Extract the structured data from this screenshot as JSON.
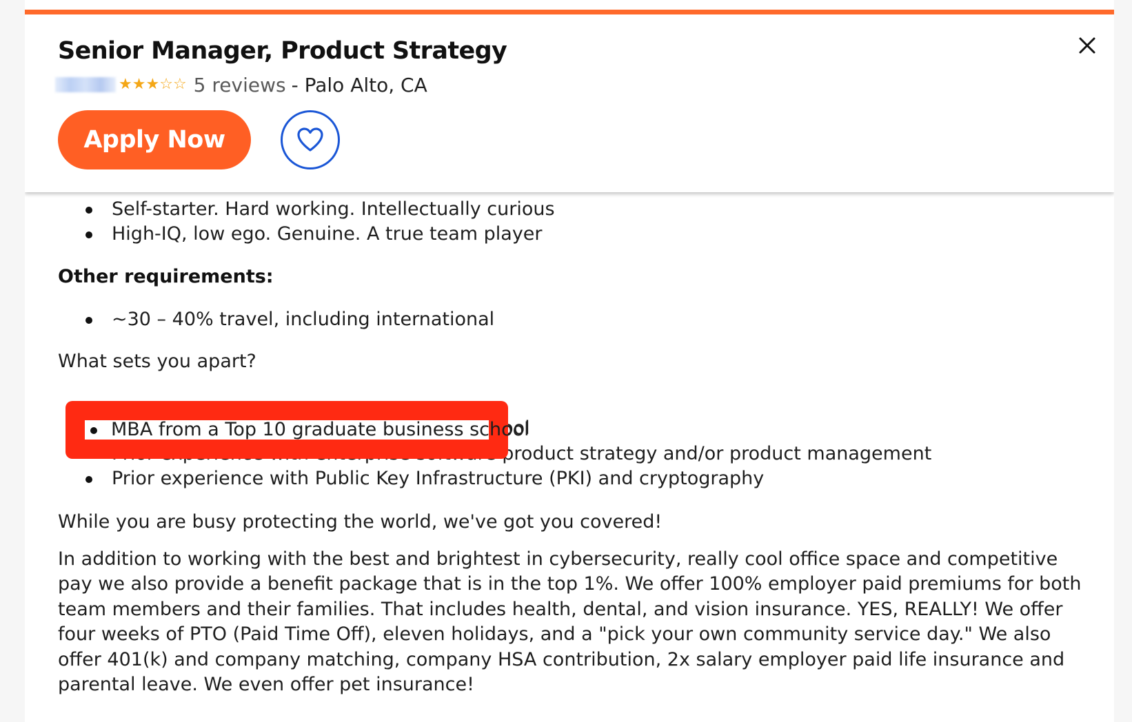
{
  "header": {
    "title": "Senior Manager, Product Strategy",
    "rating": 3,
    "max_rating": 5,
    "reviews": "5 reviews",
    "location_separator": "-",
    "location": "Palo Alto, CA",
    "apply_label": "Apply Now",
    "accent_color": "#ff6a2b",
    "apply_color": "#ff5f24",
    "save_color": "#1a56d6"
  },
  "body": {
    "traits": [
      "Self-starter. Hard working. Intellectually curious",
      "High-IQ, low ego. Genuine. A true team player"
    ],
    "other_requirements_heading": "Other requirements:",
    "other_requirements": [
      "~30 – 40% travel, including international"
    ],
    "sets_apart_heading": "What sets you apart?",
    "sets_apart": [
      "MBA from a Top 10 graduate business school",
      "Prior experience with enterprise software product strategy and/or product management",
      "Prior experience with Public Key Infrastructure (PKI) and cryptography"
    ],
    "covered_line": "While you are busy protecting the world, we've got you covered!",
    "benefits_paragraph": "In addition to working with the best and brightest in cybersecurity, really cool office space and competitive pay we also provide a benefit package that is in the top 1%. We offer 100% employer paid premiums for both team members and their families. That includes health, dental, and vision insurance. YES, REALLY! We offer four weeks of PTO (Paid Time Off), eleven holidays, and a \"pick your own community service day.\" We also offer 401(k) and company matching, company HSA contribution, 2x salary employer paid life insurance and parental leave. We even offer pet insurance!"
  },
  "annotation": {
    "highlight_color": "#ff2a12"
  }
}
